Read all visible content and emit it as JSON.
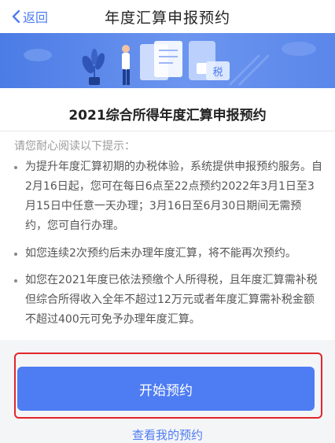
{
  "nav": {
    "back_label": "返回",
    "title": "年度汇算申报预约"
  },
  "banner": {
    "tax_badge": "税"
  },
  "card": {
    "title": "2021综合所得年度汇算申报预约",
    "hint": "请您耐心阅读以下提示：",
    "items": [
      "为提升年度汇算初期的办税体验，系统提供申报预约服务。自2月16日起，您可在每日6点至22点预约2022年3月1日至3月15日中任意一天办理；3月16日至6月30日期间无需预约，您可自行办理。",
      "如您连续2次预约后未办理年度汇算，将不能再次预约。",
      "如您在2021年度已依法预缴个人所得税，且年度汇算需补税但综合所得收入全年不超过12万元或者年度汇算需补税金额不超过400元可免予办理年度汇算。"
    ]
  },
  "actions": {
    "start_label": "开始预约",
    "view_label": "查看我的预约"
  },
  "colors": {
    "accent": "#4e7cf3",
    "highlight_box": "#e2262c"
  }
}
